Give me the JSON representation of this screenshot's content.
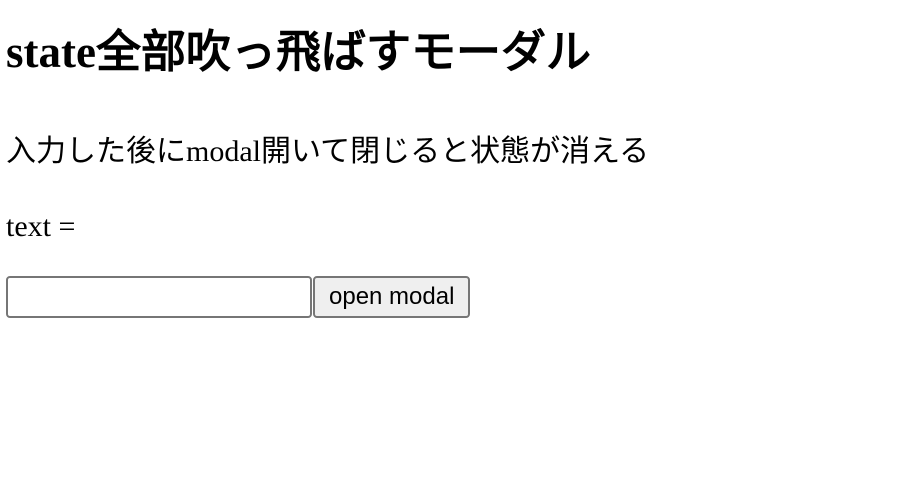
{
  "page": {
    "title": "state全部吹っ飛ばすモーダル",
    "description": "入力した後にmodal開いて閉じると状態が消える",
    "text_readout": "text ="
  },
  "form": {
    "input_value": "",
    "input_placeholder": "",
    "open_modal_label": "open modal"
  }
}
